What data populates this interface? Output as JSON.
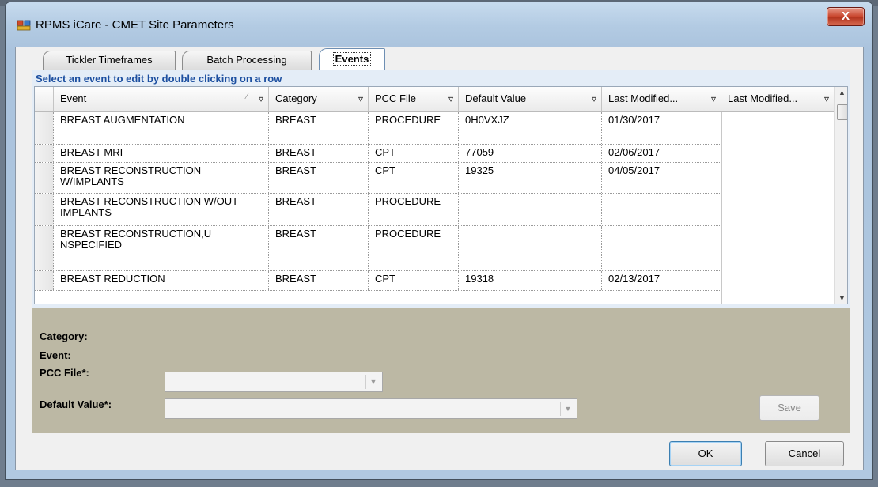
{
  "window": {
    "title": "RPMS iCare - CMET Site Parameters",
    "close_label": "X"
  },
  "tabs": [
    {
      "label": "Tickler Timeframes",
      "selected": false
    },
    {
      "label": "Batch Processing",
      "selected": false
    },
    {
      "label": "Events",
      "selected": true
    }
  ],
  "events_panel": {
    "instruction": "Select an event to edit by double clicking on a row"
  },
  "grid": {
    "columns": [
      "Event",
      "Category",
      "PCC File",
      "Default Value",
      "Last Modified...",
      "Last Modified..."
    ],
    "rows": [
      {
        "event": "BREAST AUGMENTATION",
        "category": "BREAST",
        "pcc_file": "PROCEDURE",
        "default_value": "0H0VXJZ",
        "last_modified": "01/30/2017"
      },
      {
        "event": "BREAST MRI",
        "category": "BREAST",
        "pcc_file": "CPT",
        "default_value": "77059",
        "last_modified": "02/06/2017"
      },
      {
        "event": "BREAST RECONSTRUCTION W/IMPLANTS",
        "category": "BREAST",
        "pcc_file": "CPT",
        "default_value": "19325",
        "last_modified": "04/05/2017"
      },
      {
        "event": "BREAST RECONSTRUCTION W/OUT IMPLANTS",
        "category": "BREAST",
        "pcc_file": "PROCEDURE",
        "default_value": "",
        "last_modified": ""
      },
      {
        "event": "BREAST RECONSTRUCTION,UNSPECIFIED",
        "category": "BREAST",
        "pcc_file": "PROCEDURE",
        "default_value": "",
        "last_modified": ""
      },
      {
        "event": "BREAST REDUCTION",
        "category": "BREAST",
        "pcc_file": "CPT",
        "default_value": "19318",
        "last_modified": "02/13/2017"
      }
    ]
  },
  "edit_form": {
    "category_label": "Category:",
    "event_label": "Event:",
    "pcc_file_label": "PCC File*:",
    "pcc_file_value": "",
    "default_value_label": "Default Value*:",
    "default_value_value": "",
    "save_label": "Save"
  },
  "footer": {
    "ok_label": "OK",
    "cancel_label": "Cancel"
  },
  "colors": {
    "instruction_text": "#1c4fa0",
    "edit_area_bg": "#bcb8a4",
    "close_button": "#c8442c"
  }
}
